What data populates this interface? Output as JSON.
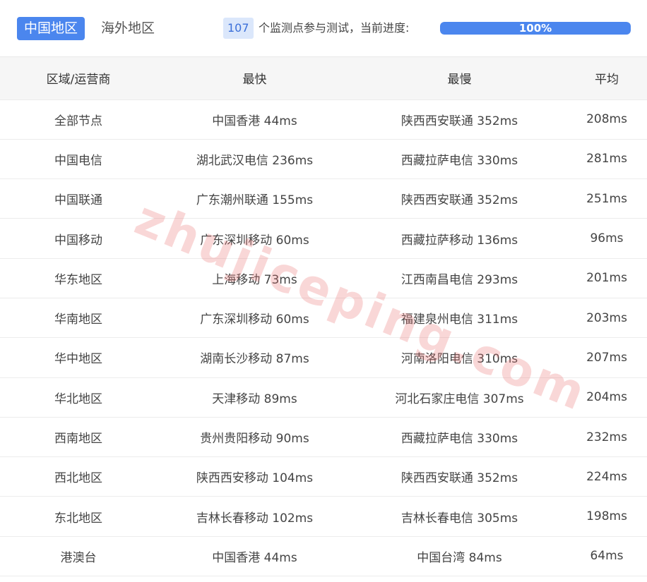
{
  "tabs": {
    "active": "中国地区",
    "inactive": "海外地区"
  },
  "progress": {
    "node_count": "107",
    "label": "个监测点参与测试，当前进度:",
    "percent_text": "100%",
    "value": 1.0,
    "color": "#4b86ee"
  },
  "table": {
    "headers": [
      "区域/运营商",
      "最快",
      "最慢",
      "平均"
    ],
    "rows": [
      [
        "全部节点",
        "中国香港 44ms",
        "陕西西安联通 352ms",
        "208ms"
      ],
      [
        "中国电信",
        "湖北武汉电信 236ms",
        "西藏拉萨电信 330ms",
        "281ms"
      ],
      [
        "中国联通",
        "广东潮州联通 155ms",
        "陕西西安联通 352ms",
        "251ms"
      ],
      [
        "中国移动",
        "广东深圳移动 60ms",
        "西藏拉萨移动 136ms",
        "96ms"
      ],
      [
        "华东地区",
        "上海移动 73ms",
        "江西南昌电信 293ms",
        "201ms"
      ],
      [
        "华南地区",
        "广东深圳移动 60ms",
        "福建泉州电信 311ms",
        "203ms"
      ],
      [
        "华中地区",
        "湖南长沙移动 87ms",
        "河南洛阳电信 310ms",
        "207ms"
      ],
      [
        "华北地区",
        "天津移动 89ms",
        "河北石家庄电信 307ms",
        "204ms"
      ],
      [
        "西南地区",
        "贵州贵阳移动 90ms",
        "西藏拉萨电信 330ms",
        "232ms"
      ],
      [
        "西北地区",
        "陕西西安移动 104ms",
        "陕西西安联通 352ms",
        "224ms"
      ],
      [
        "东北地区",
        "吉林长春移动 102ms",
        "吉林长春电信 305ms",
        "198ms"
      ],
      [
        "港澳台",
        "中国香港 44ms",
        "中国台湾 84ms",
        "64ms"
      ]
    ]
  },
  "watermark": "zhujiceping.com"
}
